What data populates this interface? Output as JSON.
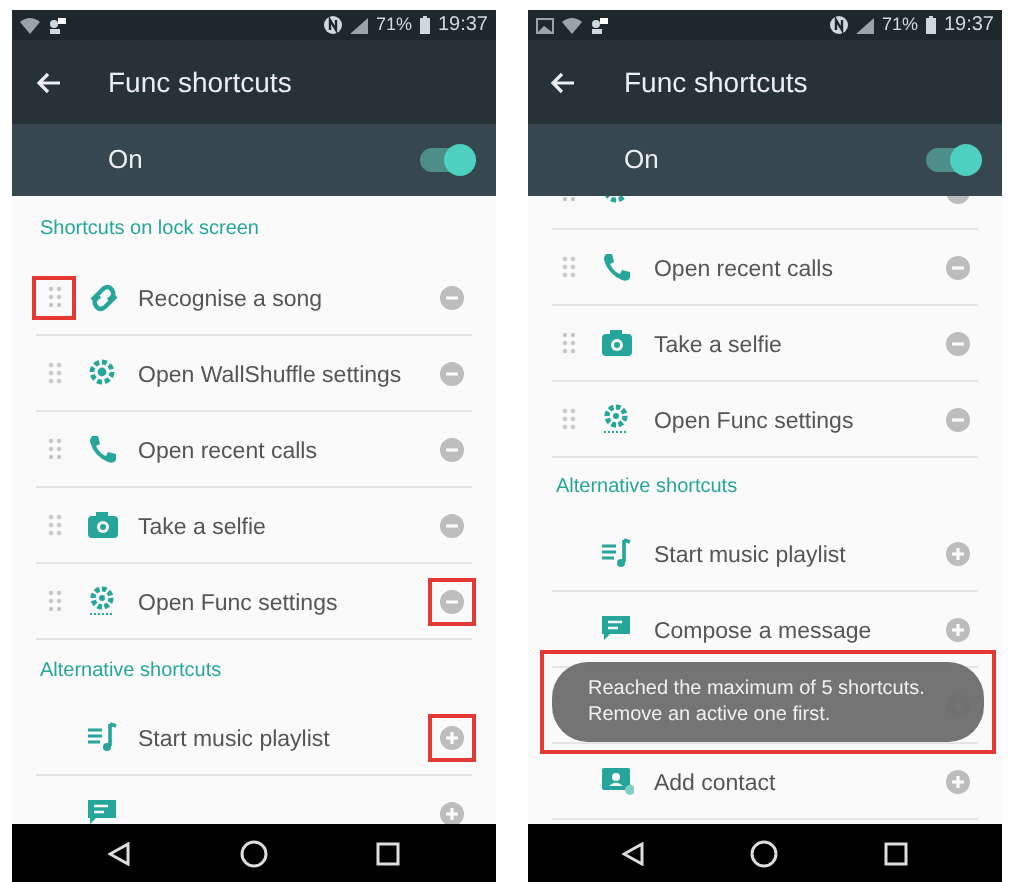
{
  "screens": [
    {
      "status_bar": {
        "image_icon": false,
        "battery": "71%",
        "time": "19:37"
      },
      "toolbar": {
        "title": "Func shortcuts"
      },
      "master_switch": {
        "label": "On",
        "on": true
      },
      "scrolled": false,
      "list": [
        {
          "kind": "header",
          "label": "Shortcuts on lock screen"
        },
        {
          "kind": "active",
          "label": "Recognise a song",
          "handle_highlighted": true,
          "action_highlighted": false
        },
        {
          "kind": "active",
          "label": "Open WallShuffle settings",
          "handle_highlighted": false,
          "action_highlighted": false
        },
        {
          "kind": "active",
          "label": "Open recent calls",
          "handle_highlighted": false,
          "action_highlighted": false
        },
        {
          "kind": "active",
          "label": "Take a selfie",
          "handle_highlighted": false,
          "action_highlighted": false
        },
        {
          "kind": "active",
          "label": "Open Func settings",
          "handle_highlighted": false,
          "action_highlighted": true
        },
        {
          "kind": "header",
          "label": "Alternative shortcuts"
        },
        {
          "kind": "alternative",
          "label": "Start music playlist",
          "action_highlighted": true
        },
        {
          "kind": "alternative",
          "action_highlighted": false
        }
      ]
    },
    {
      "status_bar": {
        "image_icon": true,
        "battery": "71%",
        "time": "19:37"
      },
      "toolbar": {
        "title": "Func shortcuts"
      },
      "master_switch": {
        "label": "On",
        "on": true
      },
      "scrolled": true,
      "list": [
        {
          "kind": "active",
          "handle_highlighted": false,
          "action_highlighted": false
        },
        {
          "kind": "active",
          "label": "Open recent calls",
          "handle_highlighted": false,
          "action_highlighted": false
        },
        {
          "kind": "active",
          "label": "Take a selfie",
          "handle_highlighted": false,
          "action_highlighted": false
        },
        {
          "kind": "active",
          "label": "Open Func settings",
          "handle_highlighted": false,
          "action_highlighted": false
        },
        {
          "kind": "header",
          "label": "Alternative shortcuts"
        },
        {
          "kind": "alternative",
          "label": "Start music playlist",
          "action_highlighted": false
        },
        {
          "kind": "alternative",
          "label": "Compose a message",
          "action_highlighted": false
        },
        {
          "kind": "alternative"
        },
        {
          "kind": "alternative",
          "label": "Add contact",
          "action_highlighted": false
        }
      ],
      "toast": {
        "lines": [
          "Reached the maximum of 5 shortcuts.",
          "Remove an active one first."
        ],
        "highlighted": true
      }
    }
  ]
}
